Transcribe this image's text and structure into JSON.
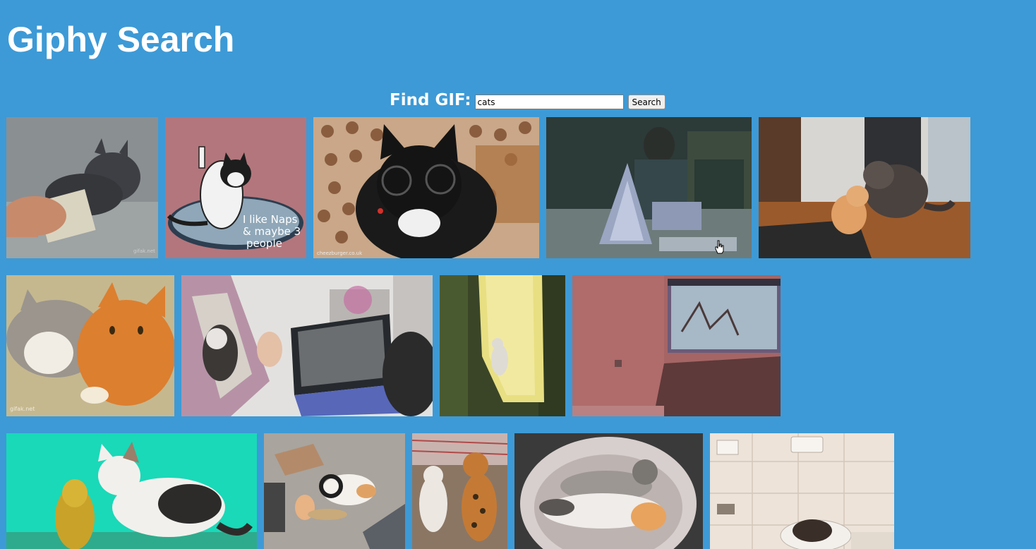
{
  "page": {
    "title": "Giphy Search",
    "background": "#3d9ad6"
  },
  "search": {
    "label": "Find GIF:",
    "value": "cats",
    "button_label": "Search"
  },
  "gifs": [
    {
      "row": 1,
      "subject": "gray kitten with money",
      "watermark": "gifak.net"
    },
    {
      "row": 1,
      "subject": "illustrated cat",
      "illustration_text_1": "I like Naps",
      "illustration_text_2": "& maybe 3",
      "illustration_text_3": "people"
    },
    {
      "row": 1,
      "subject": "cat with glasses",
      "watermark": "cheezburger.co.uk"
    },
    {
      "row": 1,
      "subject": "card house"
    },
    {
      "row": 1,
      "subject": "two cats on floor"
    },
    {
      "row": 2,
      "subject": "cuddling cats",
      "watermark": "gifak.net"
    },
    {
      "row": 2,
      "subject": "cat in photo frame with laptop"
    },
    {
      "row": 2,
      "subject": "kitten on slide"
    },
    {
      "row": 2,
      "subject": "cat and aquarium"
    },
    {
      "row": 3,
      "subject": "kitten with golden cat"
    },
    {
      "row": 3,
      "subject": "cat with scratcher"
    },
    {
      "row": 3,
      "subject": "two kittens standing"
    },
    {
      "row": 3,
      "subject": "kittens in basket"
    },
    {
      "row": 3,
      "subject": "kitten on toilet"
    }
  ]
}
